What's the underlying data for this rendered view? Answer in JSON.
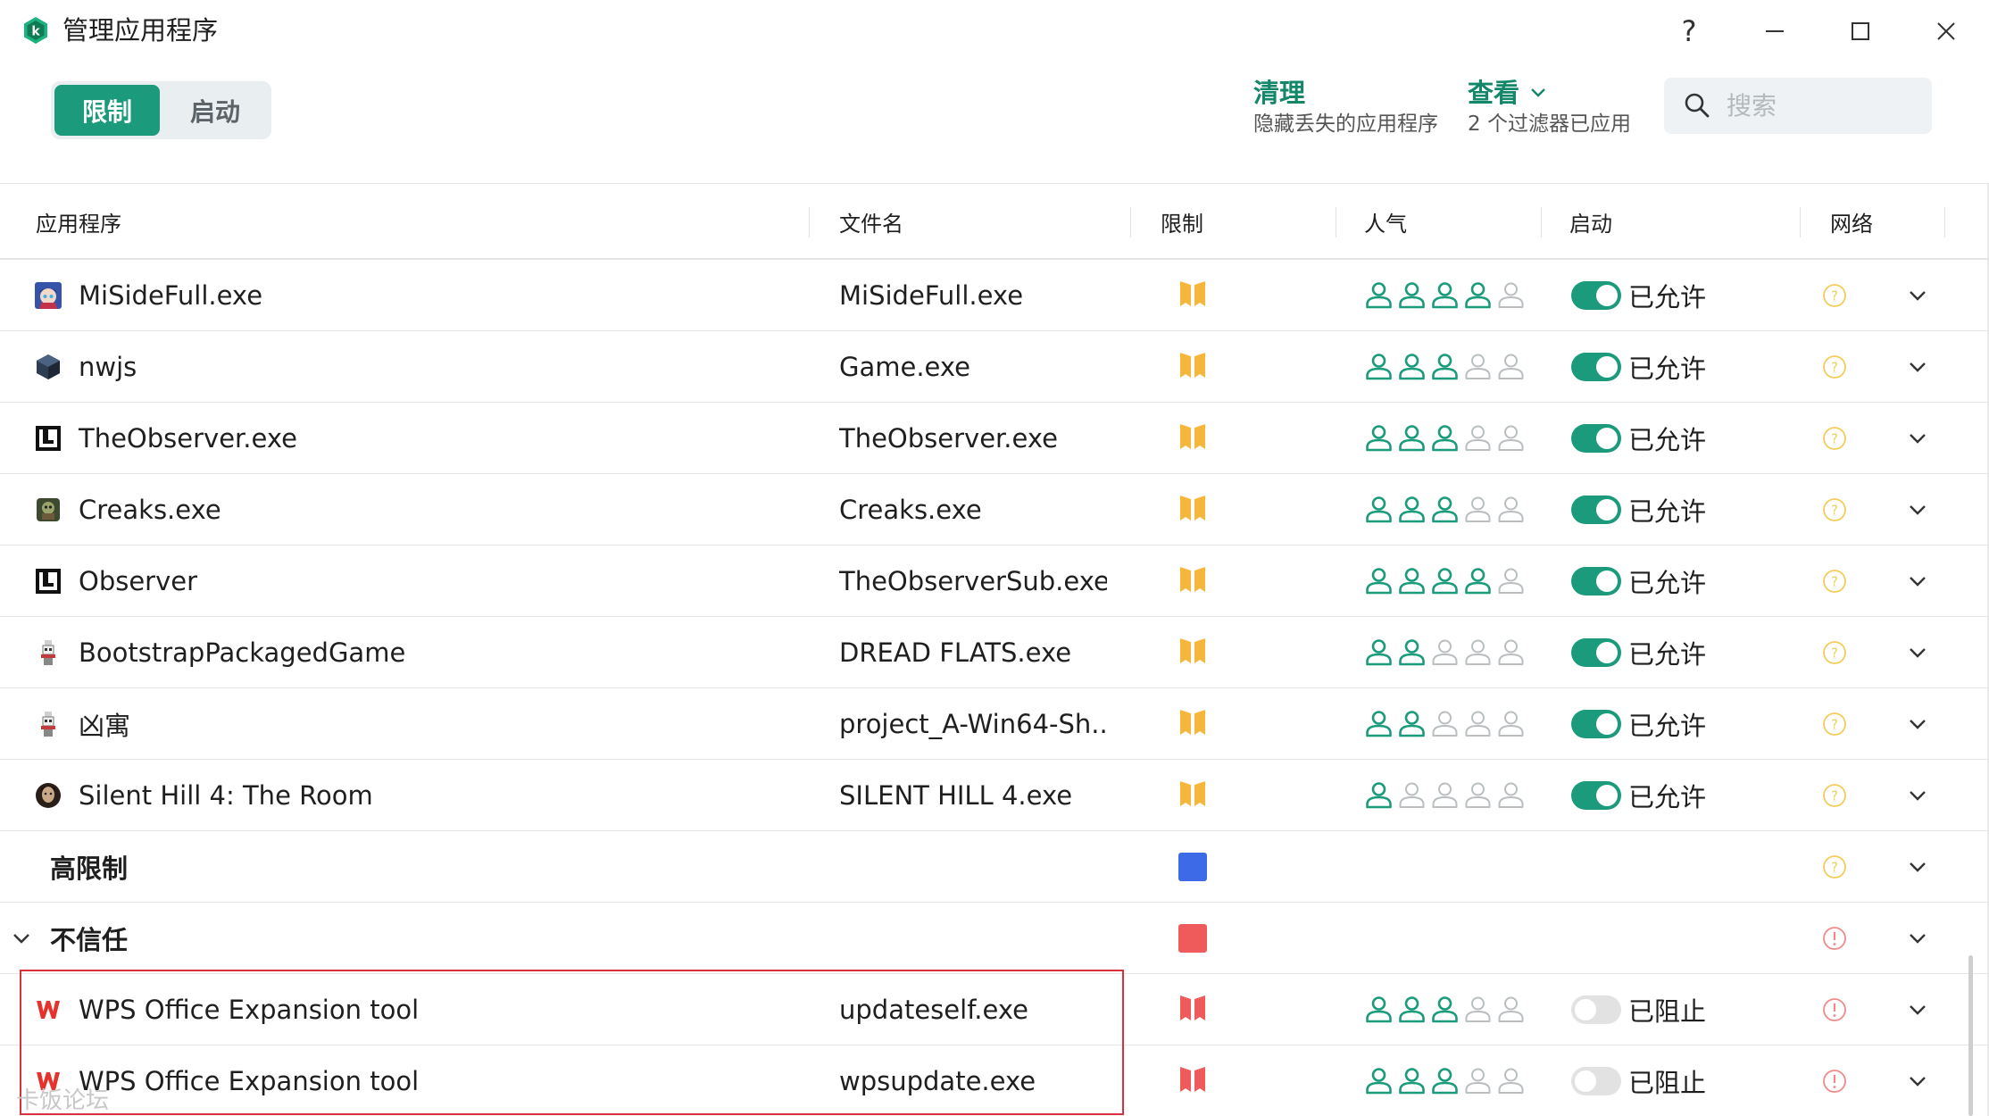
{
  "window": {
    "title": "管理应用程序",
    "help": "?",
    "brand_color": "#1b9b7b"
  },
  "modes": {
    "active": "限制",
    "inactive": "启动"
  },
  "actions": {
    "clean_title": "清理",
    "clean_sub": "隐藏丢失的应用程序",
    "view_title": "查看",
    "view_sub": "2 个过滤器已应用"
  },
  "search": {
    "placeholder": "搜索"
  },
  "columns": {
    "app": "应用程序",
    "file": "文件名",
    "restrict": "限制",
    "popularity": "人气",
    "startup": "启动",
    "network": "网络"
  },
  "rows": [
    {
      "name": "MiSideFull.exe",
      "file": "MiSideFull.exe",
      "popularity": 4,
      "startup": "已允许",
      "on": true,
      "icon": "anime-avatar-icon"
    },
    {
      "name": "nwjs",
      "file": "Game.exe",
      "popularity": 3,
      "startup": "已允许",
      "on": true,
      "icon": "nwjs-icon"
    },
    {
      "name": "TheObserver.exe",
      "file": "TheObserver.exe",
      "popularity": 3,
      "startup": "已允许",
      "on": true,
      "icon": "observer-icon"
    },
    {
      "name": "Creaks.exe",
      "file": "Creaks.exe",
      "popularity": 3,
      "startup": "已允许",
      "on": true,
      "icon": "creaks-icon"
    },
    {
      "name": "Observer",
      "file": "TheObserverSub.exe",
      "popularity": 4,
      "startup": "已允许",
      "on": true,
      "icon": "observer-icon"
    },
    {
      "name": "BootstrapPackagedGame",
      "file": "DREAD FLATS.exe",
      "popularity": 2,
      "startup": "已允许",
      "on": true,
      "icon": "unreal-game-icon"
    },
    {
      "name": "凶寓",
      "file": "project_A-Win64-Sh...",
      "popularity": 2,
      "startup": "已允许",
      "on": true,
      "icon": "unreal-game-icon"
    },
    {
      "name": "Silent Hill 4: The Room",
      "file": "SILENT HILL 4.exe",
      "popularity": 1,
      "startup": "已允许",
      "on": true,
      "icon": "silent-hill-icon"
    }
  ],
  "groups": {
    "high": "高限制",
    "untrusted": "不信任",
    "high_color": "#3d6be8",
    "untrusted_color": "#ef5a5a"
  },
  "untrusted_rows": [
    {
      "name": "WPS Office Expansion tool",
      "file": "updateself.exe",
      "popularity": 3,
      "startup": "已阻止",
      "on": false,
      "icon": "wps-icon"
    },
    {
      "name": "WPS Office Expansion tool",
      "file": "wpsupdate.exe",
      "popularity": 3,
      "startup": "已阻止",
      "on": false,
      "icon": "wps-icon"
    }
  ],
  "watermark": "卡饭论坛"
}
